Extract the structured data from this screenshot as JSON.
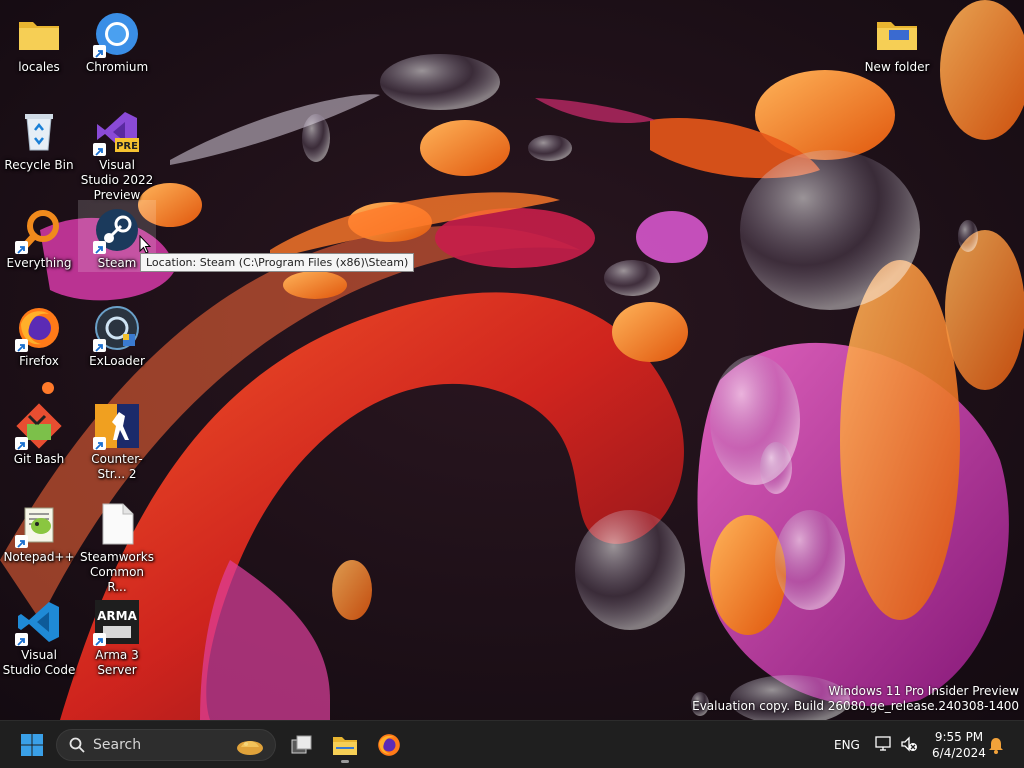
{
  "desktop": {
    "icons": [
      {
        "label": "locales",
        "icon": "folder-icon"
      },
      {
        "label": "Chromium",
        "icon": "chromium-icon"
      },
      {
        "label": "Recycle Bin",
        "icon": "recycle-bin-icon"
      },
      {
        "label": "Visual Studio 2022 Preview",
        "icon": "visual-studio-icon",
        "badge": "PRE"
      },
      {
        "label": "Everything",
        "icon": "everything-search-icon"
      },
      {
        "label": "Steam",
        "icon": "steam-icon"
      },
      {
        "label": "Firefox",
        "icon": "firefox-icon"
      },
      {
        "label": "ExLoader",
        "icon": "exloader-icon"
      },
      {
        "label": "Git Bash",
        "icon": "git-bash-icon"
      },
      {
        "label": "Counter-Str... 2",
        "icon": "counter-strike-icon"
      },
      {
        "label": "Notepad++",
        "icon": "notepad-plus-plus-icon"
      },
      {
        "label": "Steamworks Common R...",
        "icon": "blank-file-icon"
      },
      {
        "label": "Visual Studio Code",
        "icon": "vscode-icon"
      },
      {
        "label": "Arma 3 Server",
        "icon": "arma-3-icon",
        "badge": "ARMA"
      },
      {
        "label": "New folder",
        "icon": "folder-icon"
      }
    ],
    "tooltip": "Location: Steam (C:\\Program Files (x86)\\Steam)",
    "watermark": {
      "line1": "Windows 11 Pro Insider Preview",
      "line2": "Evaluation copy. Build 26080.ge_release.240308-1400"
    }
  },
  "taskbar": {
    "search_placeholder": "Search",
    "apps": [
      "Task View",
      "File Explorer",
      "Firefox"
    ],
    "language": "ENG",
    "time": "9:55 PM",
    "date": "6/4/2024"
  },
  "colors": {
    "taskbar_bg": "#1f1f1f",
    "windows_blue": "#3aa0e8",
    "folder_yellow": "#f4c84a",
    "accent_orange": "#f07a1c"
  }
}
